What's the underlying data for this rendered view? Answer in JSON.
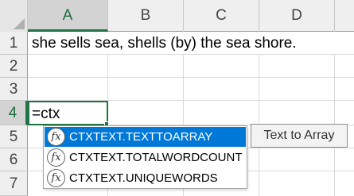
{
  "columns": [
    "A",
    "B",
    "C",
    "D"
  ],
  "rows": [
    "1",
    "2",
    "3",
    "4",
    "5",
    "6",
    "7"
  ],
  "cells": {
    "A1": "she sells sea, shells (by) the sea shore.",
    "A4": "=ctx"
  },
  "active_cell": "A4",
  "autocomplete": {
    "icon_symbol": "fx",
    "items": [
      {
        "label": "CTXTEXT.TEXTTOARRAY",
        "selected": true
      },
      {
        "label": "CTXTEXT.TOTALWORDCOUNT",
        "selected": false
      },
      {
        "label": "CTXTEXT.UNIQUEWORDS",
        "selected": false
      }
    ]
  },
  "tooltip": "Text to Array",
  "colors": {
    "accent_green": "#217346",
    "selection_blue": "#0078d7"
  }
}
